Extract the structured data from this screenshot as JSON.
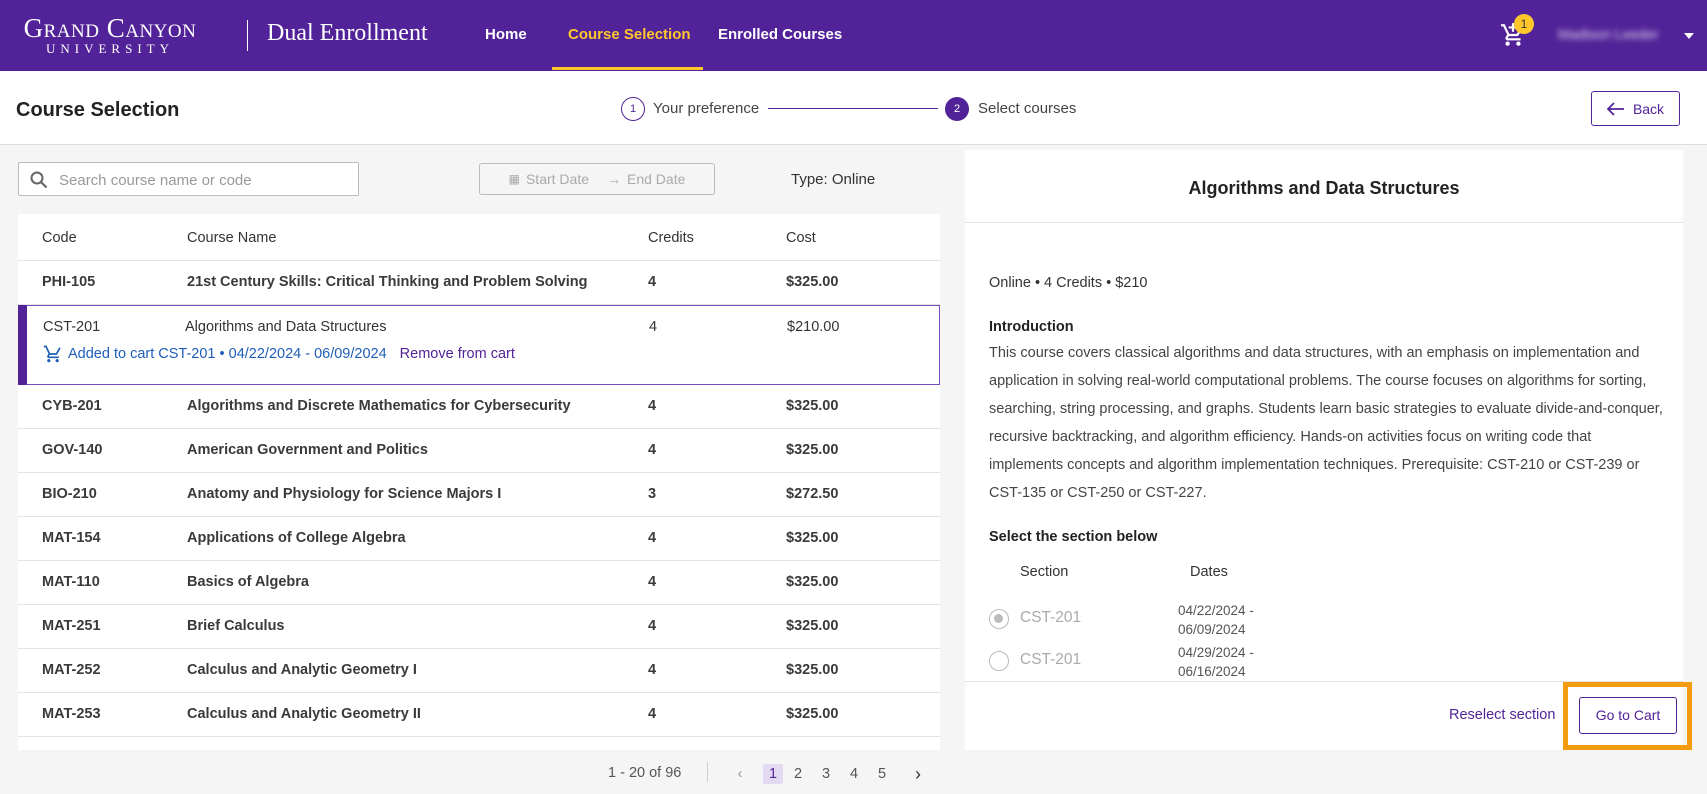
{
  "header": {
    "logo_line1": "Grand Canyon",
    "logo_line2": "UNIVERSITY",
    "app_title": "Dual Enrollment",
    "nav": {
      "home": "Home",
      "course_selection": "Course Selection",
      "enrolled_courses": "Enrolled Courses"
    },
    "cart_count": "1",
    "user_name": "Madison Leeder",
    "colors": {
      "brand": "#522398",
      "accent": "#ffc72c"
    }
  },
  "subheader": {
    "page_title": "Course Selection",
    "steps": [
      {
        "number": "1",
        "label": "Your preference"
      },
      {
        "number": "2",
        "label": "Select courses"
      }
    ],
    "back_label": "Back"
  },
  "filters": {
    "search_placeholder": "Search course name or code",
    "start_date_placeholder": "Start Date",
    "end_date_placeholder": "End Date",
    "type_label": "Type: Online"
  },
  "table": {
    "columns": {
      "code": "Code",
      "name": "Course Name",
      "credits": "Credits",
      "cost": "Cost"
    },
    "rows": [
      {
        "code": "PHI-105",
        "name": "21st Century Skills: Critical Thinking and Problem Solving",
        "credits": "4",
        "cost": "$325.00"
      },
      {
        "code": "CST-201",
        "name": "Algorithms and Data Structures",
        "credits": "4",
        "cost": "$210.00"
      },
      {
        "code": "CYB-201",
        "name": "Algorithms and Discrete Mathematics for Cybersecurity",
        "credits": "4",
        "cost": "$325.00"
      },
      {
        "code": "GOV-140",
        "name": "American Government and Politics",
        "credits": "4",
        "cost": "$325.00"
      },
      {
        "code": "BIO-210",
        "name": "Anatomy and Physiology for Science Majors I",
        "credits": "3",
        "cost": "$272.50"
      },
      {
        "code": "MAT-154",
        "name": "Applications of College Algebra",
        "credits": "4",
        "cost": "$325.00"
      },
      {
        "code": "MAT-110",
        "name": "Basics of Algebra",
        "credits": "4",
        "cost": "$325.00"
      },
      {
        "code": "MAT-251",
        "name": "Brief Calculus",
        "credits": "4",
        "cost": "$325.00"
      },
      {
        "code": "MAT-252",
        "name": "Calculus and Analytic Geometry I",
        "credits": "4",
        "cost": "$325.00"
      },
      {
        "code": "MAT-253",
        "name": "Calculus and Analytic Geometry II",
        "credits": "4",
        "cost": "$325.00"
      }
    ],
    "selected_cart_status": "Added to cart CST-201 • 04/22/2024 - 06/09/2024",
    "remove_label": "Remove from cart"
  },
  "pagination": {
    "range": "1 - 20 of 96",
    "pages": [
      "1",
      "2",
      "3",
      "4",
      "5"
    ]
  },
  "detail": {
    "title": "Algorithms and Data Structures",
    "meta": "Online  •  4 Credits  •  $210",
    "intro_heading": "Introduction",
    "intro_text": "This course covers classical algorithms and data structures, with an emphasis on implementation and application in solving real-world computational problems. The course focuses on algorithms for sorting, searching, string processing, and graphs. Students learn basic strategies to evaluate divide-and-conquer, recursive backtracking, and algorithm efficiency. Hands-on activities focus on writing code that implements concepts and algorithm implementation techniques. Prerequisite: CST-210 or CST-239 or CST-135 or CST-250 or CST-227.",
    "section_heading": "Select the section below",
    "section_col": "Section",
    "dates_col": "Dates",
    "sections": [
      {
        "code": "CST-201",
        "start": "04/22/2024 -",
        "end": "06/09/2024"
      },
      {
        "code": "CST-201",
        "start": "04/29/2024 -",
        "end": "06/16/2024"
      }
    ],
    "reselect_label": "Reselect section",
    "cart_label": "Go to Cart"
  }
}
